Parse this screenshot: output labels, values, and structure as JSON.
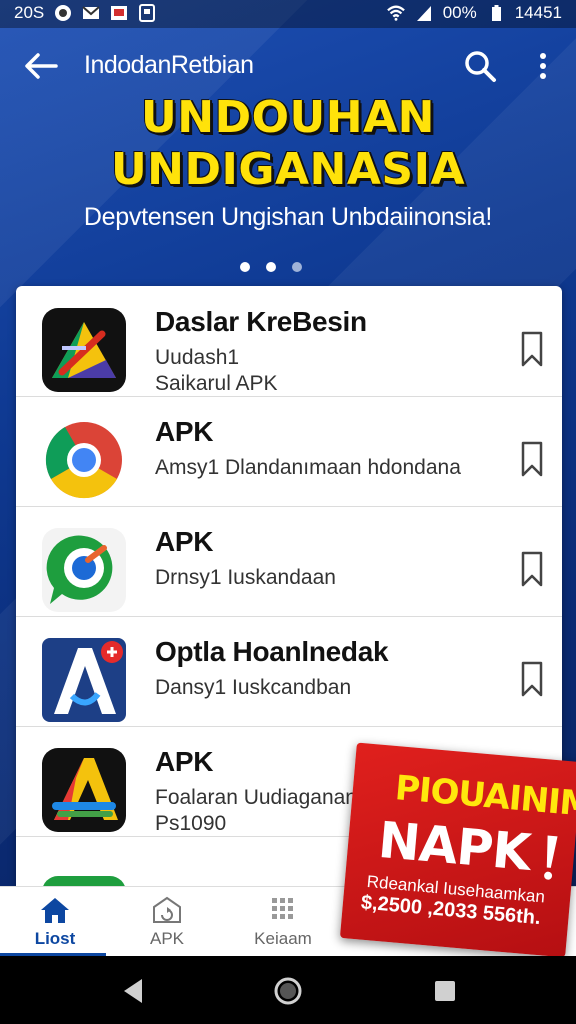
{
  "status_bar": {
    "time_left": "20S",
    "battery": "00%",
    "time_right": "14451"
  },
  "app_bar": {
    "title": "IndodanRetbian"
  },
  "hero": {
    "title_line1": "UNDOUHAN",
    "title_line2": "UNDIGANASIA",
    "subtitle": "Depvtensen Ungishan Unbdaiinonsia!"
  },
  "apps": [
    {
      "name": "Daslar KreBesin",
      "line1": "Uudash1",
      "line2": "Saikarul APK"
    },
    {
      "name": "APK",
      "line1": "Amsy1  Dlandanımaan hdondana",
      "line2": ""
    },
    {
      "name": "APK",
      "line1": "Drnsy1  Iuskandaan",
      "line2": ""
    },
    {
      "name": "Optla Hoanlnedak",
      "line1": "Dansy1  Iuskcandban",
      "line2": ""
    },
    {
      "name": "APK",
      "line1": "Foalaran  Uudiaganan",
      "line2": "Ps1090"
    }
  ],
  "bottom_nav": [
    {
      "label": "Liost",
      "active": true
    },
    {
      "label": "APK",
      "active": false
    },
    {
      "label": "Keiaam",
      "active": false
    }
  ],
  "promo": {
    "title": "PIOUAINIM",
    "big": "NAPK",
    "line1": "Rdeankal Iusehaamkan",
    "line2": "$,2500 ,2033 556th."
  },
  "colors": {
    "accent": "#0d47a1",
    "hero_yellow": "#ffe20a",
    "promo_red": "#d61a1a"
  }
}
